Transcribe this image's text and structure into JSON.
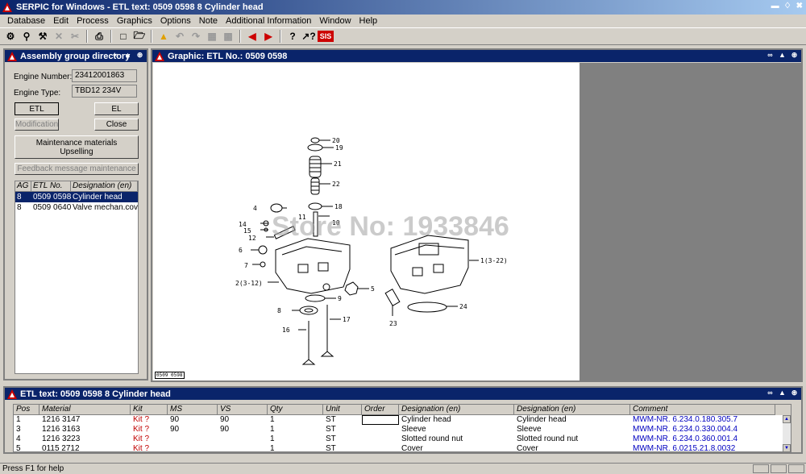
{
  "window": {
    "title": "SERPIC for Windows - ETL text: 0509 0598   8  Cylinder head"
  },
  "menu": [
    "Database",
    "Edit",
    "Process",
    "Graphics",
    "Options",
    "Note",
    "Additional Information",
    "Window",
    "Help"
  ],
  "toolbar": {
    "sis_label": "SIS"
  },
  "left_panel": {
    "title": "Assembly group directory",
    "engine_number_label": "Engine Number:",
    "engine_number_value": "23412001863",
    "engine_type_label": "Engine Type:",
    "engine_type_value": "TBD12  234V",
    "etl_button": "ETL",
    "el_button": "EL",
    "modification_button": "Modification",
    "close_button": "Close",
    "maintenance_line1": "Maintenance materials",
    "maintenance_line2": "Upselling",
    "feedback_button": "Feedback message maintenance",
    "columns": [
      "AG",
      "ETL No.",
      "Designation (en)"
    ],
    "rows": [
      {
        "ag": "8",
        "etl": "0509 0598",
        "designation": "Cylinder head",
        "selected": true
      },
      {
        "ag": "8",
        "etl": "0509 0640",
        "designation": "Valve mechan.cover",
        "selected": false
      }
    ]
  },
  "graphic_panel": {
    "title": "Graphic: ETL No.: 0509 0598",
    "drawing_tag": "0509 0598",
    "watermark": "Store No: 1933846",
    "callouts": [
      "20",
      "19",
      "21",
      "22",
      "18",
      "4",
      "11",
      "10",
      "14",
      "15",
      "12",
      "6",
      "7",
      "5",
      "9",
      "8",
      "17",
      "16",
      "2(3-12)",
      "1(3-22)",
      "24",
      "23"
    ]
  },
  "etl_panel": {
    "title": "ETL text: 0509 0598   8  Cylinder head",
    "columns": [
      "Pos",
      "Material",
      "Kit",
      "MS",
      "VS",
      "Qty",
      "Unit",
      "Order",
      "Designation (en)",
      "Designation (en)",
      "Comment"
    ],
    "rows": [
      {
        "pos": "1",
        "material": "1216 3147",
        "kit": "Kit ?",
        "ms": "90",
        "vs": "90",
        "qty": "1",
        "unit": "ST",
        "order": "",
        "des1": "Cylinder head",
        "des2": "Cylinder head",
        "comment": "MWM-NR. 6.234.0.180.305.7"
      },
      {
        "pos": "3",
        "material": "1216 3163",
        "kit": "Kit ?",
        "ms": "90",
        "vs": "90",
        "qty": "1",
        "unit": "ST",
        "order": "",
        "des1": "Sleeve",
        "des2": "Sleeve",
        "comment": "MWM-NR. 6.234.0.330.004.4"
      },
      {
        "pos": "4",
        "material": "1216 3223",
        "kit": "Kit ?",
        "ms": "",
        "vs": "",
        "qty": "1",
        "unit": "ST",
        "order": "",
        "des1": "Slotted round nut",
        "des2": "Slotted round nut",
        "comment": "MWM-NR. 6.234.0.360.001.4"
      },
      {
        "pos": "5",
        "material": "0115 2712",
        "kit": "Kit ?",
        "ms": "",
        "vs": "",
        "qty": "1",
        "unit": "ST",
        "order": "",
        "des1": "Cover",
        "des2": "Cover",
        "comment": "MWM-NR. 6.0215.21.8.0032"
      }
    ]
  },
  "status": {
    "text": "Press F1 for help"
  }
}
